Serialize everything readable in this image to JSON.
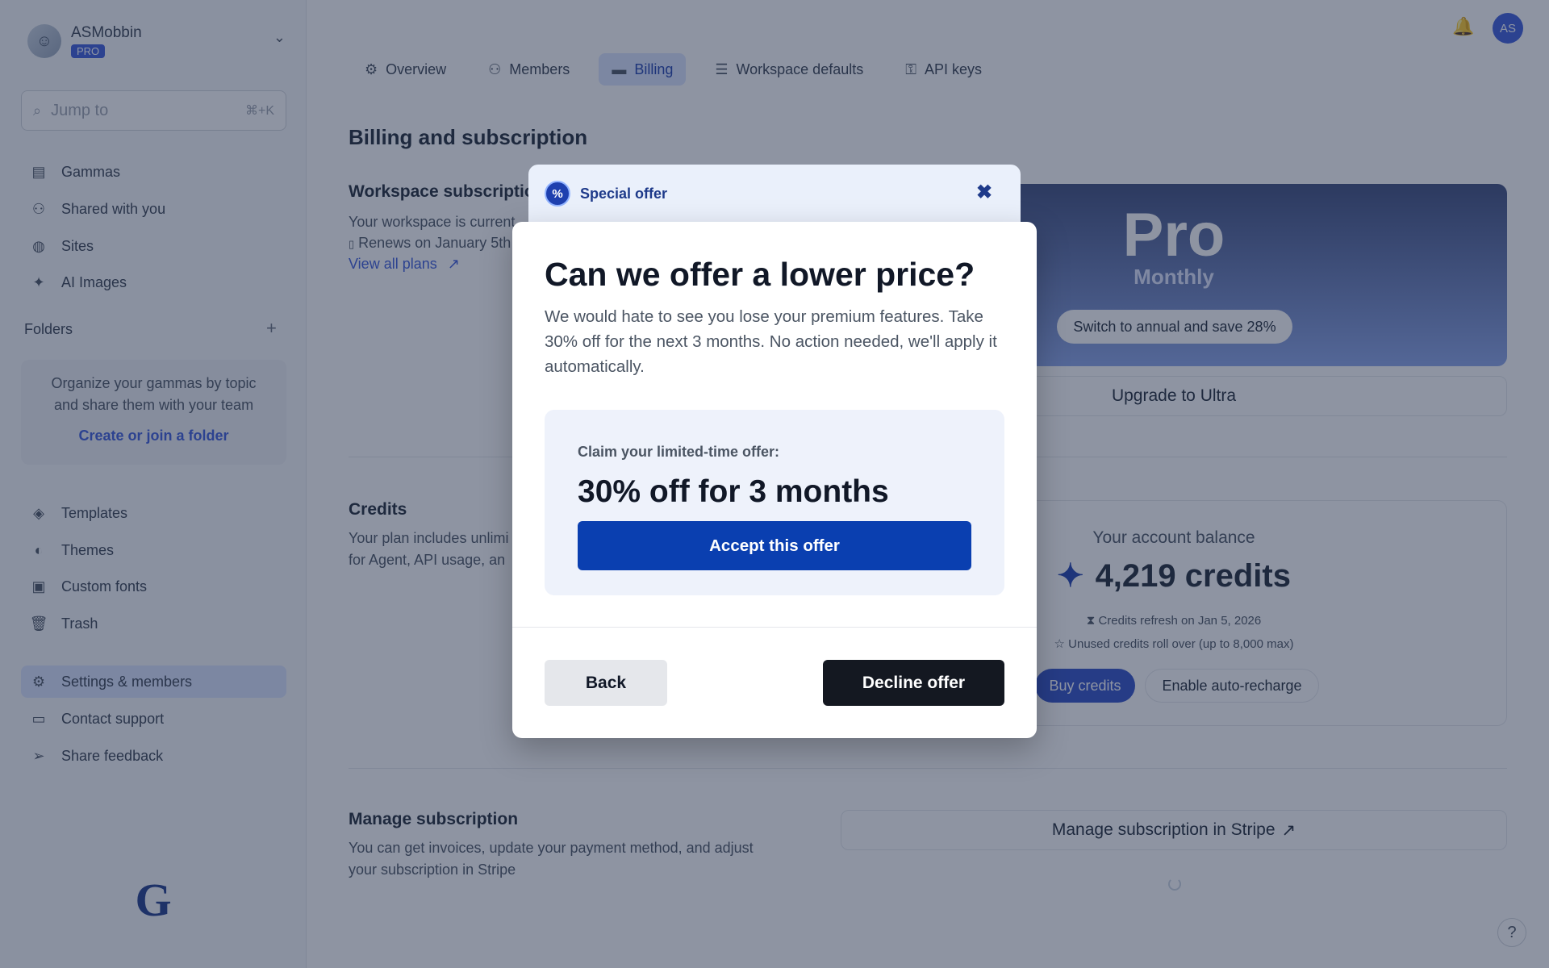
{
  "sidebar": {
    "workspace_name": "ASMobbin",
    "plan_badge": "PRO",
    "search_placeholder": "Jump to",
    "search_shortcut": "⌘+K",
    "nav": [
      {
        "label": "Gammas",
        "icon": "stack-icon"
      },
      {
        "label": "Shared with you",
        "icon": "users-icon"
      },
      {
        "label": "Sites",
        "icon": "globe-icon"
      },
      {
        "label": "AI Images",
        "icon": "sparkle-icon"
      }
    ],
    "folders_label": "Folders",
    "folders_desc": "Organize your gammas by topic and share them with your team",
    "folders_link": "Create or join a folder",
    "nav2": [
      {
        "label": "Templates",
        "icon": "layers-icon"
      },
      {
        "label": "Themes",
        "icon": "palette-icon"
      },
      {
        "label": "Custom fonts",
        "icon": "font-icon"
      },
      {
        "label": "Trash",
        "icon": "trash-icon"
      }
    ],
    "nav3": [
      {
        "label": "Settings & members",
        "icon": "gears-icon"
      },
      {
        "label": "Contact support",
        "icon": "chat-icon"
      },
      {
        "label": "Share feedback",
        "icon": "send-icon"
      }
    ]
  },
  "header": {
    "tabs": [
      {
        "label": "Overview",
        "icon": "gears-icon"
      },
      {
        "label": "Members",
        "icon": "users-icon"
      },
      {
        "label": "Billing",
        "icon": "card-icon"
      },
      {
        "label": "Workspace defaults",
        "icon": "sliders-icon"
      },
      {
        "label": "API keys",
        "icon": "key-icon"
      }
    ],
    "active_tab": "Billing",
    "user_initials": "AS"
  },
  "main": {
    "title": "Billing and subscription",
    "workspace_sub_title": "Workspace subscriptio",
    "workspace_sub_desc1": "Your workspace is current",
    "workspace_sub_desc2": "Renews on January 5th",
    "view_plans": "View all plans",
    "plan_name": "Pro",
    "plan_period": "Monthly",
    "switch_annual": "Switch to annual and save 28%",
    "upgrade": "Upgrade to Ultra",
    "credits_title": "Credits",
    "credits_desc1": "Your plan includes unlimi",
    "credits_desc2": "for Agent, API usage, an",
    "balance_label": "Your account balance",
    "balance_value": "4,219 credits",
    "refresh_text": "Credits refresh on Jan 5, 2026",
    "rollover_text": "Unused credits roll over (up to 8,000 max)",
    "buy_credits": "Buy credits",
    "enable_recharge": "Enable auto-recharge",
    "manage_title": "Manage subscription",
    "manage_desc": "You can get invoices, update your payment method, and adjust your subscription in Stripe",
    "manage_stripe": "Manage subscription in Stripe",
    "help": "?"
  },
  "modal": {
    "tab_label": "Special offer",
    "heading": "Can we offer a lower price?",
    "body": "We would hate to see you lose your premium features. Take 30% off for the next 3 months. No action needed, we'll apply it automatically.",
    "claim_label": "Claim your limited-time offer:",
    "claim_title": "30% off for 3 months",
    "accept": "Accept this offer",
    "back": "Back",
    "decline": "Decline offer"
  },
  "colors": {
    "accent": "#3b5bdb",
    "accept_button": "#0a3fb0",
    "decline_button": "#141821",
    "overlay": "#1e2a46"
  }
}
